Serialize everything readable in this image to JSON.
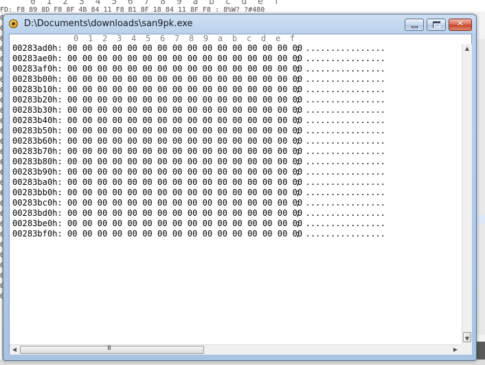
{
  "background": {
    "header_digits": "0 1 2 3 4 5 6 7 8 9 a b c d e f",
    "hex_line": "FD: F8 89 8D F8 8F 4B 84 11 F8 B1 8F 18 84 11 8F F8 : 8%W? ?#480",
    "left_glyphs": [
      "0",
      "0",
      "0",
      "0",
      "0",
      "0",
      "0",
      "0",
      "0",
      "0",
      "0",
      "0",
      "0",
      "0",
      "0",
      "0",
      "0",
      "0",
      "0",
      "0",
      "0",
      "0",
      "0",
      "0",
      "0",
      "0",
      "0",
      "0"
    ]
  },
  "window": {
    "title": "D:\\Documents\\downloads\\san9pk.exe",
    "controls": {
      "minimize": "",
      "maximize": "",
      "close": "✕"
    }
  },
  "hex_view": {
    "column_header": [
      "0",
      "1",
      "2",
      "3",
      "4",
      "5",
      "6",
      "7",
      "8",
      "9",
      "a",
      "b",
      "c",
      "d",
      "e",
      "f"
    ],
    "rows": [
      {
        "address": "00283ad0h:",
        "hex": "00 00 00 00 00 00 00 00 00 00 00 00 00 00 00 00",
        "ascii": "; ................"
      },
      {
        "address": "00283ae0h:",
        "hex": "00 00 00 00 00 00 00 00 00 00 00 00 00 00 00 00",
        "ascii": "; ................"
      },
      {
        "address": "00283af0h:",
        "hex": "00 00 00 00 00 00 00 00 00 00 00 00 00 00 00 00",
        "ascii": "; ................"
      },
      {
        "address": "00283b00h:",
        "hex": "00 00 00 00 00 00 00 00 00 00 00 00 00 00 00 00",
        "ascii": "; ................"
      },
      {
        "address": "00283b10h:",
        "hex": "00 00 00 00 00 00 00 00 00 00 00 00 00 00 00 00",
        "ascii": "; ................"
      },
      {
        "address": "00283b20h:",
        "hex": "00 00 00 00 00 00 00 00 00 00 00 00 00 00 00 00",
        "ascii": "; ................"
      },
      {
        "address": "00283b30h:",
        "hex": "00 00 00 00 00 00 00 00 00 00 00 00 00 00 00 00",
        "ascii": "; ................"
      },
      {
        "address": "00283b40h:",
        "hex": "00 00 00 00 00 00 00 00 00 00 00 00 00 00 00 00",
        "ascii": "; ................"
      },
      {
        "address": "00283b50h:",
        "hex": "00 00 00 00 00 00 00 00 00 00 00 00 00 00 00 00",
        "ascii": "; ................"
      },
      {
        "address": "00283b60h:",
        "hex": "00 00 00 00 00 00 00 00 00 00 00 00 00 00 00 00",
        "ascii": "; ................"
      },
      {
        "address": "00283b70h:",
        "hex": "00 00 00 00 00 00 00 00 00 00 00 00 00 00 00 00",
        "ascii": "; ................"
      },
      {
        "address": "00283b80h:",
        "hex": "00 00 00 00 00 00 00 00 00 00 00 00 00 00 00 00",
        "ascii": "; ................"
      },
      {
        "address": "00283b90h:",
        "hex": "00 00 00 00 00 00 00 00 00 00 00 00 00 00 00 00",
        "ascii": "; ................"
      },
      {
        "address": "00283ba0h:",
        "hex": "00 00 00 00 00 00 00 00 00 00 00 00 00 00 00 00",
        "ascii": "; ................"
      },
      {
        "address": "00283bb0h:",
        "hex": "00 00 00 00 00 00 00 00 00 00 00 00 00 00 00 00",
        "ascii": "; ................"
      },
      {
        "address": "00283bc0h:",
        "hex": "00 00 00 00 00 00 00 00 00 00 00 00 00 00 00 00",
        "ascii": "; ................"
      },
      {
        "address": "00283bd0h:",
        "hex": "00 00 00 00 00 00 00 00 00 00 00 00 00 00 00 00",
        "ascii": "; ................"
      },
      {
        "address": "00283be0h:",
        "hex": "00 00 00 00 00 00 00 00 00 00 00 00 00 00 00 00",
        "ascii": "; ................"
      },
      {
        "address": "00283bf0h:",
        "hex": "00 00 00 00 00 00 00 00 00 00 00 00 00 00 00 00",
        "ascii": "; ................"
      }
    ]
  },
  "scrollbars": {
    "horizontal_grip": "III",
    "left_arrow": "◀",
    "right_arrow": "▶",
    "up_arrow": "▲",
    "down_arrow": "▼"
  }
}
